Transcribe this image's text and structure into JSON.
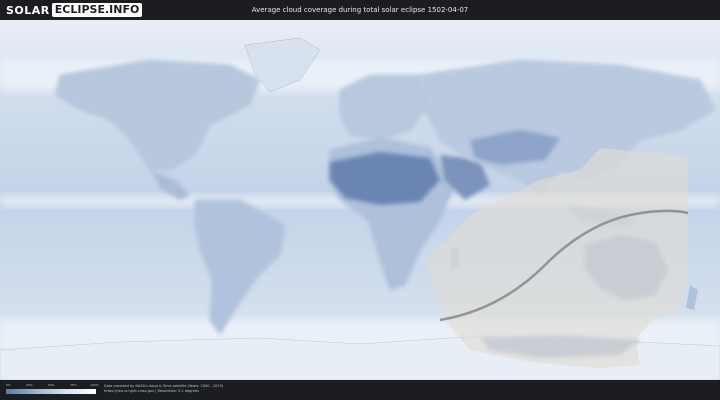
{
  "header": {
    "logo_part1": "SOLAR",
    "logo_part2": "ECLIPSE.INFO",
    "title": "Average cloud coverage during total solar eclipse 1502-04-07"
  },
  "legend": {
    "scale_ticks": [
      "0%",
      "25%",
      "50%",
      "75%",
      "100%"
    ],
    "colors": {
      "low": "#5b7aa8",
      "mid": "#9cb3d4",
      "high": "#ffffff"
    }
  },
  "credits": {
    "line1": "Data provided by NASA's Aqua & Terra satellite (Years: 2000 - 2019)",
    "line2": "https://neo.sci.gsfc.nasa.gov  |  Resolution: 0.1 degrees"
  },
  "map": {
    "background_color": "#c9d7ea",
    "land_color": "#b3c4dc",
    "desert_color": "#6b85b2",
    "shadow_color": "#dcdad5",
    "path_color": "#8a8c8e"
  }
}
